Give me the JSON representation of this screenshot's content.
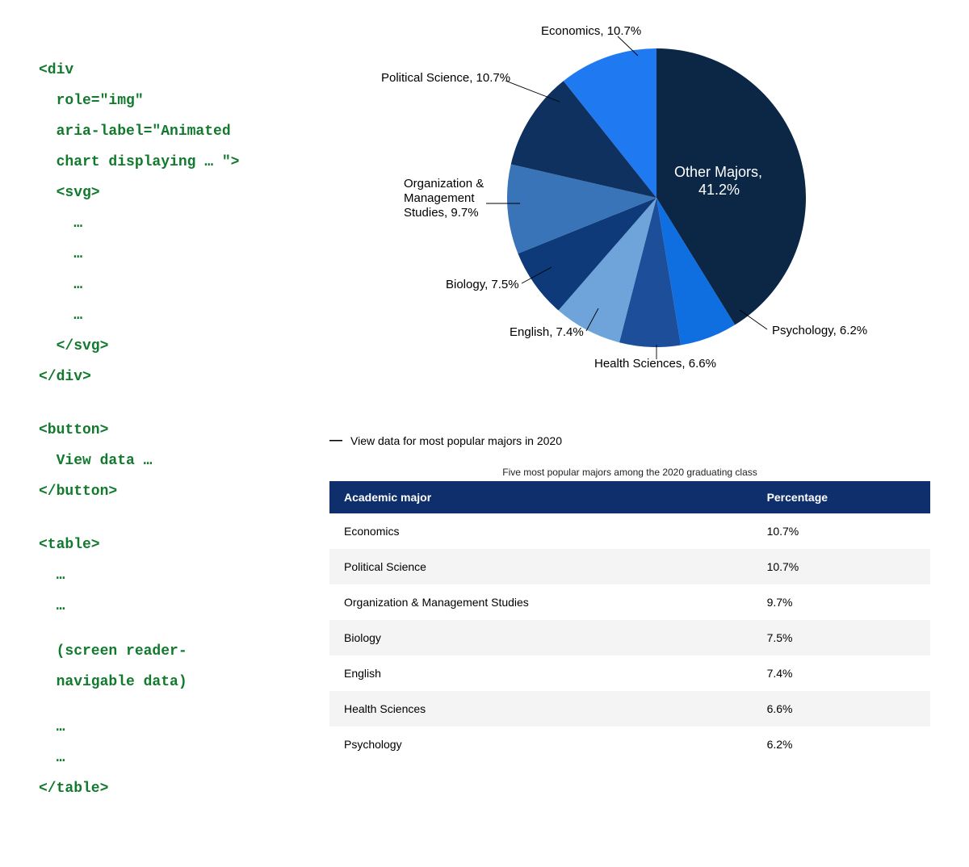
{
  "code": {
    "div_open": "<div",
    "attr_role": "  role=\"img\"",
    "attr_aria1": "  aria-label=\"Animated",
    "attr_aria2": "  chart displaying … \">",
    "svg_open": "  <svg>",
    "ell1": "    …",
    "ell2": "    …",
    "ell3": "    …",
    "ell4": "    …",
    "svg_close": "  </svg>",
    "div_close": "</div>",
    "btn_open": "<button>",
    "btn_text": "  View data …",
    "btn_close": "</button>",
    "tbl_open": "<table>",
    "tbl_e1": "  …",
    "tbl_e2": "  …",
    "tbl_note1": "  (screen reader-",
    "tbl_note2": "  navigable data)",
    "tbl_e3": "  …",
    "tbl_e4": "  …",
    "tbl_close": "</table>"
  },
  "chart_labels": {
    "economics": "Economics, 10.7%",
    "political": "Political Science, 10.7%",
    "org1": "Organization &",
    "org2": "Management",
    "org3": "Studies, 9.7%",
    "biology": "Biology, 7.5%",
    "english": "English, 7.4%",
    "health": "Health Sciences, 6.6%",
    "psychology": "Psychology, 6.2%",
    "other1": "Other Majors,",
    "other2": "41.2%"
  },
  "disclosure": {
    "icon": "—",
    "label": "View data for most popular majors in 2020"
  },
  "table": {
    "caption": "Five most popular majors among the 2020 graduating class",
    "col_major": "Academic major",
    "col_pct": "Percentage",
    "rows": [
      {
        "major": "Economics",
        "pct": "10.7%"
      },
      {
        "major": "Political Science",
        "pct": "10.7%"
      },
      {
        "major": "Organization & Management Studies",
        "pct": "9.7%"
      },
      {
        "major": "Biology",
        "pct": "7.5%"
      },
      {
        "major": "English",
        "pct": "7.4%"
      },
      {
        "major": "Health Sciences",
        "pct": "6.6%"
      },
      {
        "major": "Psychology",
        "pct": "6.2%"
      }
    ]
  },
  "chart_data": {
    "type": "pie",
    "title": "Five most popular majors among the 2020 graduating class",
    "series": [
      {
        "name": "Other Majors",
        "value": 41.2,
        "color": "#0c2646"
      },
      {
        "name": "Psychology",
        "value": 6.2,
        "color": "#0f6fe0"
      },
      {
        "name": "Health Sciences",
        "value": 6.6,
        "color": "#1d4e99"
      },
      {
        "name": "English",
        "value": 7.4,
        "color": "#6ea4da"
      },
      {
        "name": "Biology",
        "value": 7.5,
        "color": "#0e3a7a"
      },
      {
        "name": "Organization & Management Studies",
        "value": 9.7,
        "color": "#3a74b8"
      },
      {
        "name": "Political Science",
        "value": 10.7,
        "color": "#0f3160"
      },
      {
        "name": "Economics",
        "value": 10.7,
        "color": "#1f7af2"
      }
    ],
    "unit": "%",
    "start_angle_deg": 0,
    "direction": "clockwise"
  }
}
